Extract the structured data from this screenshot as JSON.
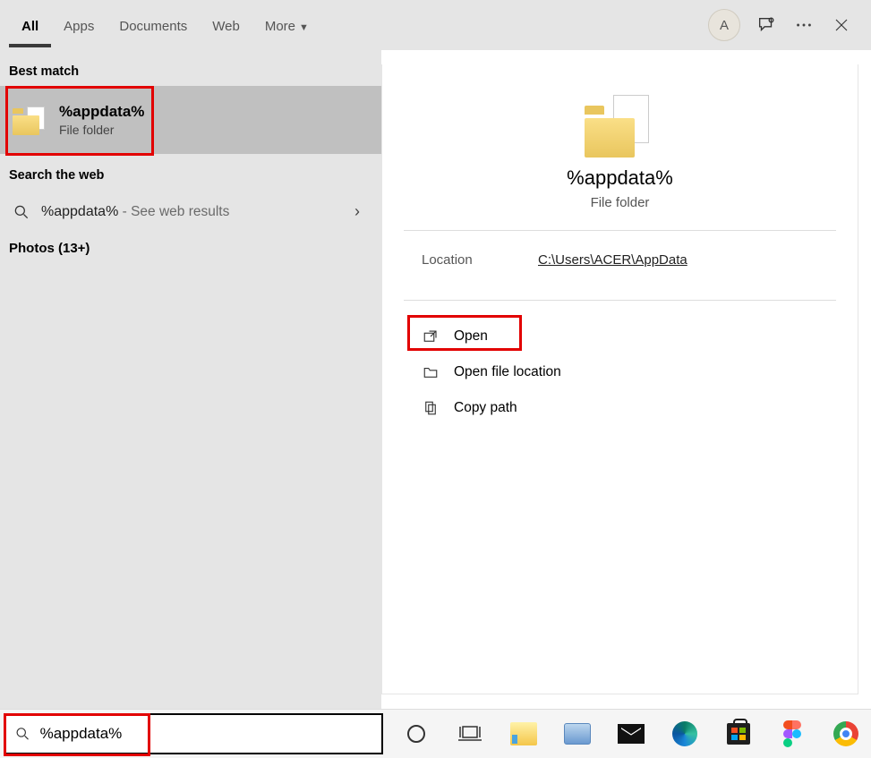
{
  "header": {
    "tabs": [
      "All",
      "Apps",
      "Documents",
      "Web",
      "More"
    ],
    "avatar_letter": "A"
  },
  "left": {
    "best_match_label": "Best match",
    "best_match": {
      "title": "%appdata%",
      "subtitle": "File folder"
    },
    "web_label": "Search the web",
    "web_result": {
      "query": "%appdata%",
      "suffix": " - See web results"
    },
    "photos_label": "Photos (13+)"
  },
  "preview": {
    "title": "%appdata%",
    "subtitle": "File folder",
    "location_label": "Location",
    "location_value": "C:\\Users\\ACER\\AppData",
    "actions": {
      "open": "Open",
      "open_location": "Open file location",
      "copy_path": "Copy path"
    }
  },
  "search": {
    "value": "%appdata%"
  }
}
